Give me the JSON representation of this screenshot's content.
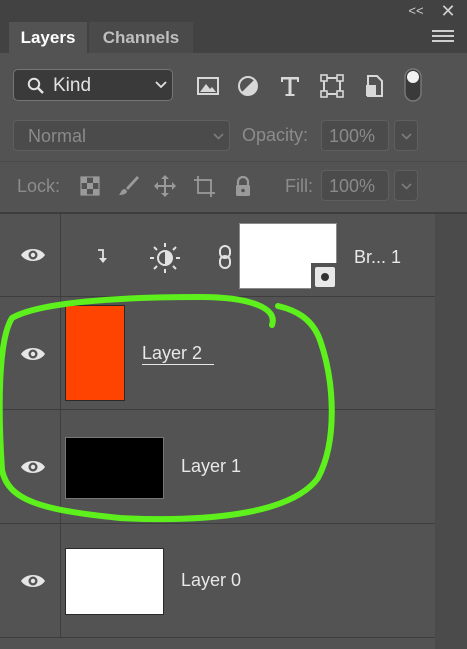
{
  "tabs": {
    "layers": "Layers",
    "channels": "Channels"
  },
  "filter": {
    "kind": "Kind"
  },
  "blend_mode": "Normal",
  "opacity": {
    "label": "Opacity:",
    "value": "100%"
  },
  "lock": {
    "label": "Lock:"
  },
  "fill": {
    "label": "Fill:",
    "value": "100%"
  },
  "layers": [
    {
      "name": "Br... 1",
      "type": "adjustment-brightness"
    },
    {
      "name": "Layer 2",
      "fill": "#ff4300",
      "selected": true
    },
    {
      "name": "Layer 1",
      "fill": "#000000"
    },
    {
      "name": "Layer 0",
      "fill": "#ffffff"
    }
  ],
  "colors": {
    "panel": "#535353",
    "annotation": "#5df01c"
  }
}
